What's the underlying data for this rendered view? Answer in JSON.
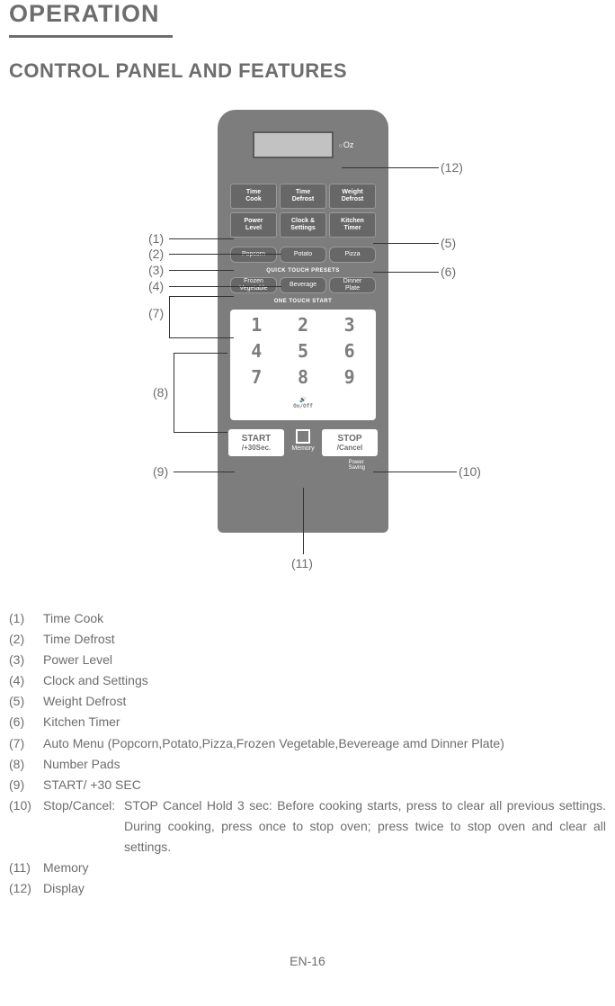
{
  "title": "OPERATION",
  "subtitle": "CONTROL PANEL AND FEATURES",
  "panel": {
    "units": [
      "Oz"
    ],
    "row1": [
      "Time\nCook",
      "Time\nDefrost",
      "Weight\nDefrost"
    ],
    "row2": [
      "Power\nLevel",
      "Clock &\nSettings",
      "Kitchen\nTimer"
    ],
    "presets1": [
      "Popcorn",
      "Potato",
      "Pizza"
    ],
    "label1": "QUICK TOUCH PRESETS",
    "presets2": [
      "Frozen\nVegetable",
      "Beverage",
      "Dinner\nPlate"
    ],
    "label2": "ONE TOUCH START",
    "keys": [
      "1",
      "2",
      "3",
      "4",
      "5",
      "6",
      "7",
      "8",
      "9"
    ],
    "key_sub": "On/Off",
    "start": "START",
    "start_sub": "/+30Sec.",
    "stop": "STOP",
    "stop_sub": "/Cancel",
    "memory": "Memory",
    "power_saving": "Power\nSaving"
  },
  "callouts": {
    "c1": "(1)",
    "c2": "(2)",
    "c3": "(3)",
    "c4": "(4)",
    "c5": "(5)",
    "c6": "(6)",
    "c7": "(7)",
    "c8": "(8)",
    "c9": "(9)",
    "c10": "(10)",
    "c11": "(11)",
    "c12": "(12)"
  },
  "legend": [
    {
      "n": "(1)",
      "t": "Time Cook"
    },
    {
      "n": "(2)",
      "t": "Time Defrost"
    },
    {
      "n": "(3)",
      "t": "Power Level"
    },
    {
      "n": "(4)",
      "t": "Clock and Settings"
    },
    {
      "n": "(5)",
      "t": "Weight Defrost"
    },
    {
      "n": "(6)",
      "t": "Kitchen Timer"
    },
    {
      "n": "(7)",
      "t": "Auto Menu (Popcorn,Potato,Pizza,Frozen Vegetable,Bevereage amd Dinner Plate)"
    },
    {
      "n": "(8)",
      "t": "Number Pads"
    },
    {
      "n": "(9)",
      "t": "START/ +30 SEC"
    }
  ],
  "legend10": {
    "n": "(10)",
    "label": "Stop/Cancel:",
    "desc": "STOP Cancel Hold 3 sec: Before cooking starts, press to clear all previous settings. During cooking, press once to stop oven; press twice to stop oven and clear all settings."
  },
  "legend_tail": [
    {
      "n": "(11)",
      "t": "Memory"
    },
    {
      "n": "(12)",
      "t": "Display"
    }
  ],
  "page": "EN-16"
}
